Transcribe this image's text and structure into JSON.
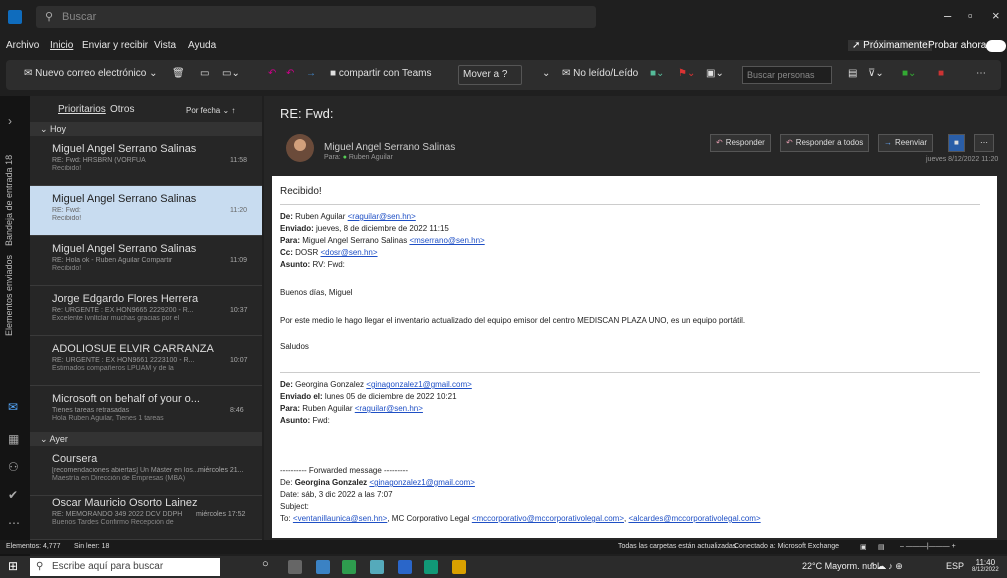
{
  "titlebar": {
    "search_placeholder": "Buscar"
  },
  "menu": {
    "items": [
      "Archivo",
      "Inicio",
      "Enviar y recibir",
      "Vista",
      "Ayuda"
    ],
    "proximamente": "Próximamente",
    "probar": "Probar ahora"
  },
  "ribbon": {
    "new_mail": "Nuevo correo electrónico",
    "teams": "compartir con Teams",
    "move": "Mover a ?",
    "read_unread": "No leído/Leído",
    "search_people": "Buscar personas"
  },
  "rail": {
    "inbox_label": "Bandeja de entrada 18",
    "sent_label": "Elementos enviados"
  },
  "list": {
    "tabs": [
      "Prioritarios",
      "Otros"
    ],
    "sort": "Por fecha",
    "group_today": "Hoy",
    "group_yesterday": "Ayer",
    "messages": [
      {
        "from": "Miguel Angel Serrano Salinas",
        "subject": "RE: Fwd: HRSBRN (VORFUA",
        "preview": "Recibido!",
        "time": "11:58"
      },
      {
        "from": "Miguel Angel Serrano Salinas",
        "subject": "RE: Fwd:",
        "preview": "Recibido!",
        "time": "11:20"
      },
      {
        "from": "Miguel Angel Serrano Salinas",
        "subject": "RE: Hola ok - Ruben Aguilar Compartir",
        "preview": "Recibido!",
        "time": "11:09"
      },
      {
        "from": "Jorge Edgardo Flores Herrera",
        "subject": "Re: URGENTE : EX HON9665 2229200 - R...",
        "preview": "Excelente Ivnltclar muchas gracias por el",
        "time": "10:37"
      },
      {
        "from": "ADOLIOSUE ELVIR CARRANZA",
        "subject": "RE: URGENTE : EX HON9661 2223100 - R...",
        "preview": "Estimados compañeros LPUAM y de la",
        "time": "10:07"
      },
      {
        "from": "Microsoft on behalf of your o...",
        "subject": "Tienes tareas retrasadas",
        "preview": "Hola Ruben Aguilar, Tienes 1 tareas",
        "time": "8:46"
      },
      {
        "from": "Coursera",
        "subject": "[recomendaciones abiertas] Un Máster en los...",
        "preview": "Maestría en Dirección de Empresas (MBA)",
        "time": "miércoles 21..."
      },
      {
        "from": "Oscar Mauricio Osorto Lainez",
        "subject": "RE: MEMORANDO 349 2022 DCV DDPH",
        "preview": "Buenos Tardes Confirmo Recepción de",
        "time": "miércoles 17:52"
      }
    ]
  },
  "reading": {
    "subject": "RE: Fwd:",
    "sender": "Miguel Angel Serrano Salinas",
    "to_prefix": "Para:",
    "to": "Ruben Aguilar",
    "buttons": [
      "Responder",
      "Responder a todos",
      "Reenviar"
    ],
    "date": "jueves 8/12/2022 11:20",
    "body": {
      "greeting": "Recibido!",
      "fwd1": {
        "de_label": "De:",
        "de": "Ruben Aguilar",
        "de_email": "<raguilar@sen.hn>",
        "enviado_label": "Enviado:",
        "enviado": "jueves, 8 de diciembre de 2022 11:15",
        "para_label": "Para:",
        "para": "Miguel Angel Serrano Salinas",
        "para_email": "<mserrano@sen.hn>",
        "cc_label": "Cc:",
        "cc": "DOSR",
        "cc_email": "<dosr@sen.hn>",
        "asunto_label": "Asunto:",
        "asunto": "RV: Fwd:"
      },
      "hello": "Buenos días, Miguel",
      "paragraph": "Por este medio le hago llegar el inventario actualizado del equipo emisor del centro MEDISCAN PLAZA UNO, es un equipo portátil.",
      "saludos": "Saludos",
      "fwd2": {
        "de_label": "De:",
        "de": "Georgina Gonzalez",
        "de_email": "<ginagonzalez1@gmail.com>",
        "enviado_label": "Enviado el:",
        "enviado": "lunes 05 de diciembre de 2022 10:21",
        "para_label": "Para:",
        "para": "Ruben Aguilar",
        "para_email": "<raguilar@sen.hn>",
        "asunto_label": "Asunto:",
        "asunto": "Fwd:"
      },
      "forwarded": "---------- Forwarded message ---------",
      "fwd3_de_label": "De:",
      "fwd3_de": "Georgina Gonzalez",
      "fwd3_email": "<ginagonzalez1@gmail.com>",
      "fwd3_date": "Date: sáb, 3 dic 2022 a las 7:07",
      "fwd3_subject": "Subject:",
      "fwd3_to_label": "To:",
      "fwd3_to1": "<ventanillaunica@sen.hn>",
      "fwd3_to_mid": ", MC Corporativo Legal ",
      "fwd3_to2": "<mccorporativo@mccorporativolegal.com>",
      "fwd3_to3": "<alcardes@mccorporativolegal.com>"
    }
  },
  "statusbar": {
    "elements": "Elementos: 4,777",
    "unread": "Sin leer: 18",
    "updated": "Todas las carpetas están actualizadas.",
    "connected": "Conectado a: Microsoft Exchange"
  },
  "taskbar": {
    "search": "Escribe aquí para buscar",
    "weather": "22°C Mayorm. nubl...",
    "lang": "ESP",
    "time": "11:40",
    "date": "8/12/2022"
  }
}
